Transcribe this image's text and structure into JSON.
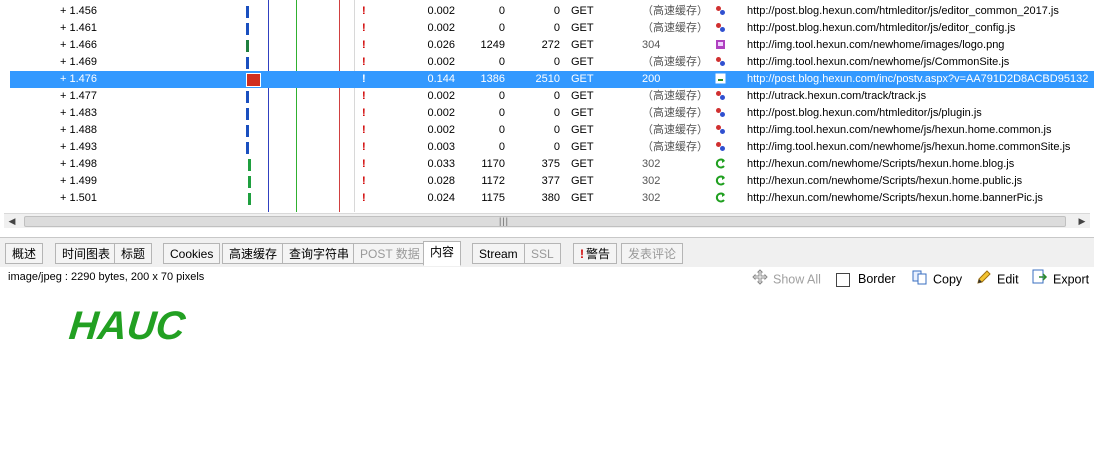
{
  "rows": [
    {
      "time": "+ 1.456",
      "duration": "0.002",
      "sent": "0",
      "received": "0",
      "method": "GET",
      "result": "（高速缓存）",
      "icon": "link-icon",
      "url": "http://post.blog.hexun.com/htmleditor/js/editor_common_2017.js"
    },
    {
      "time": "+ 1.461",
      "duration": "0.002",
      "sent": "0",
      "received": "0",
      "method": "GET",
      "result": "（高速缓存）",
      "icon": "link-icon",
      "url": "http://post.blog.hexun.com/htmleditor/js/editor_config.js"
    },
    {
      "time": "+ 1.466",
      "duration": "0.026",
      "sent": "1249",
      "received": "272",
      "method": "GET",
      "result": "304",
      "icon": "image-icon",
      "url": "http://img.tool.hexun.com/newhome/images/logo.png"
    },
    {
      "time": "+ 1.469",
      "duration": "0.002",
      "sent": "0",
      "received": "0",
      "method": "GET",
      "result": "（高速缓存）",
      "icon": "link-icon",
      "url": "http://img.tool.hexun.com/newhome/js/CommonSite.js"
    },
    {
      "time": "+ 1.476",
      "duration": "0.144",
      "sent": "1386",
      "received": "2510",
      "method": "GET",
      "result": "200",
      "icon": "document-icon",
      "url": "http://post.blog.hexun.com/inc/postv.aspx?v=AA791D2D8ACBD95132",
      "selected": true
    },
    {
      "time": "+ 1.477",
      "duration": "0.002",
      "sent": "0",
      "received": "0",
      "method": "GET",
      "result": "（高速缓存）",
      "icon": "link-icon",
      "url": "http://utrack.hexun.com/track/track.js"
    },
    {
      "time": "+ 1.483",
      "duration": "0.002",
      "sent": "0",
      "received": "0",
      "method": "GET",
      "result": "（高速缓存）",
      "icon": "link-icon",
      "url": "http://post.blog.hexun.com/htmleditor/js/plugin.js"
    },
    {
      "time": "+ 1.488",
      "duration": "0.002",
      "sent": "0",
      "received": "0",
      "method": "GET",
      "result": "（高速缓存）",
      "icon": "link-icon",
      "url": "http://img.tool.hexun.com/newhome/js/hexun.home.common.js"
    },
    {
      "time": "+ 1.493",
      "duration": "0.003",
      "sent": "0",
      "received": "0",
      "method": "GET",
      "result": "（高速缓存）",
      "icon": "link-icon",
      "url": "http://img.tool.hexun.com/newhome/js/hexun.home.commonSite.js"
    },
    {
      "time": "+ 1.498",
      "duration": "0.033",
      "sent": "1170",
      "received": "375",
      "method": "GET",
      "result": "302",
      "icon": "redirect-icon",
      "url": "http://hexun.com/newhome/Scripts/hexun.home.blog.js"
    },
    {
      "time": "+ 1.499",
      "duration": "0.028",
      "sent": "1172",
      "received": "377",
      "method": "GET",
      "result": "302",
      "icon": "redirect-icon",
      "url": "http://hexun.com/newhome/Scripts/hexun.home.public.js"
    },
    {
      "time": "+ 1.501",
      "duration": "0.024",
      "sent": "1175",
      "received": "380",
      "method": "GET",
      "result": "302",
      "icon": "redirect-icon",
      "url": "http://hexun.com/newhome/Scripts/hexun.home.bannerPic.js"
    }
  ],
  "tabs": [
    {
      "label": "概述",
      "state": "normal"
    },
    {
      "label": "时间图表",
      "state": "normal"
    },
    {
      "label": "标题",
      "state": "normal"
    },
    {
      "label": "Cookies",
      "state": "normal"
    },
    {
      "label": "高速缓存",
      "state": "normal"
    },
    {
      "label": "查询字符串",
      "state": "normal"
    },
    {
      "label": "POST 数据",
      "state": "disabled"
    },
    {
      "label": "内容",
      "state": "active"
    },
    {
      "label": "Stream",
      "state": "normal"
    },
    {
      "label": "SSL",
      "state": "disabled"
    },
    {
      "label": "警告",
      "state": "normal"
    },
    {
      "label": "发表评论",
      "state": "disabled"
    }
  ],
  "content": {
    "info": "image/jpeg : 2290 bytes, 200 x 70 pixels",
    "preview_text": "HAUC"
  },
  "toolbar": {
    "show_all": "Show All",
    "border": "Border",
    "copy": "Copy",
    "edit": "Edit",
    "export": "Export"
  },
  "colors": {
    "selection": "#3399ff",
    "warning": "#d00000",
    "preview_green": "#22a022"
  }
}
